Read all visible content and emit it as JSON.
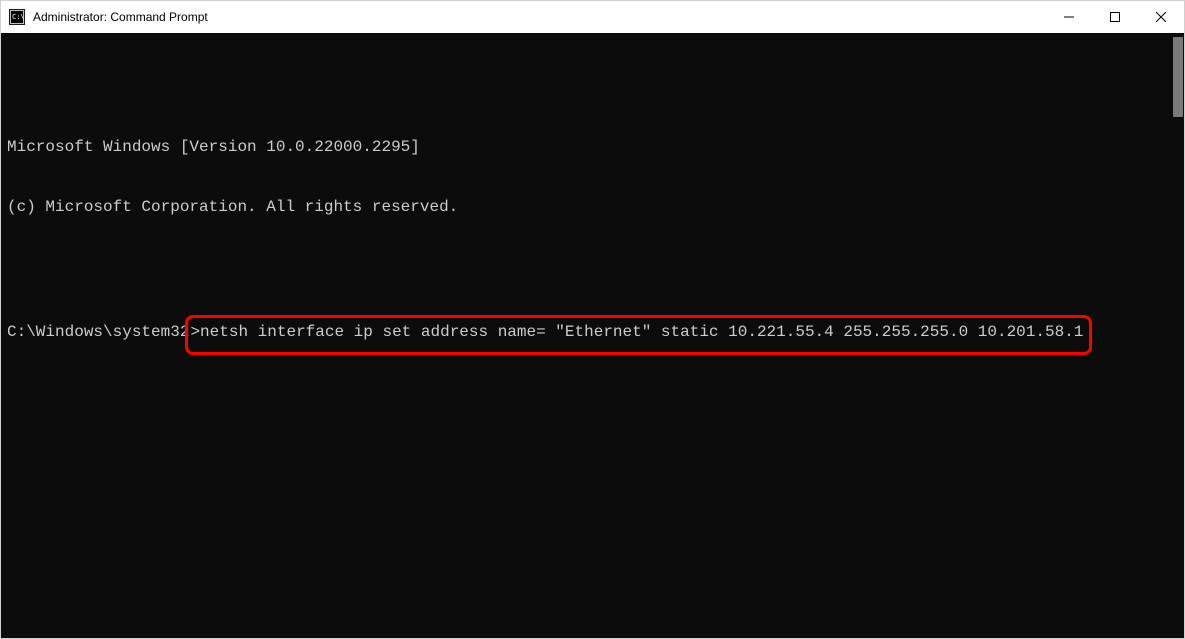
{
  "window": {
    "title": "Administrator: Command Prompt"
  },
  "terminal": {
    "line1": "Microsoft Windows [Version 10.0.22000.2295]",
    "line2": "(c) Microsoft Corporation. All rights reserved.",
    "prompt_path": "C:\\Windows\\system32",
    "prompt_symbol": ">",
    "command": "netsh interface ip set address name= \"Ethernet\" static 10.221.55.4 255.255.255.0 10.201.58.1"
  }
}
